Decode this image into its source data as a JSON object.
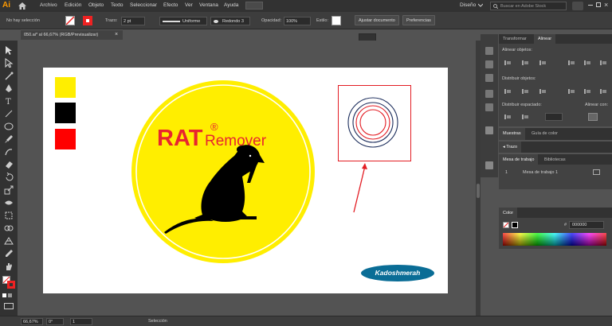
{
  "app": {
    "logo": "Ai",
    "workspace": "Diseño",
    "search_placeholder": "Buscar en Adobe Stock"
  },
  "menu": [
    "Archivo",
    "Edición",
    "Objeto",
    "Texto",
    "Seleccionar",
    "Efecto",
    "Ver",
    "Ventana",
    "Ayuda"
  ],
  "control": {
    "selection": "No hay selección",
    "stroke_label": "Trazo:",
    "stroke_value": "2 pt",
    "profile": "Uniforme",
    "brush": "Redondo 3",
    "opacity_label": "Opacidad:",
    "opacity_value": "100%",
    "style_label": "Estilo:",
    "adjust_button": "Ajustar documento",
    "prefs_button": "Preferencias"
  },
  "document": {
    "tab_title": "050.ai* al 66,67% (RGB/Previsualizar)",
    "close": "×"
  },
  "artwork": {
    "brand_rat": "RAT",
    "brand_remover": "Remover",
    "registered": "®",
    "watermark": "Kadoshmerah",
    "swatch_colors": [
      "#ffee00",
      "#000000",
      "#ff0000"
    ],
    "circle_color": "#ffee00",
    "accent_red": "#e8252f",
    "watermark_bg": "#0a6d96"
  },
  "status": {
    "zoom": "66,67%",
    "rotation": "0°",
    "artboard": "1",
    "tool": "Selección"
  },
  "panels": {
    "top_tabs": [
      "Transformar",
      "Alinear"
    ],
    "align_objects": "Alinear objetos:",
    "distribute_objects": "Distribuir objetos:",
    "distribute_spacing": "Distribuir espaciado:",
    "align_to": "Alinear con:",
    "swatch_tabs": [
      "Muestras",
      "Guía de color"
    ],
    "stroke_tab": "Trazo",
    "artboard_tabs": [
      "Mesa de trabajo",
      "Bibliotecas"
    ],
    "artboard_row_num": "1",
    "artboard_row_name": "Mesa de trabajo 1",
    "color_tab": "Color",
    "color_hex_prefix": "#",
    "color_hex": "000000"
  }
}
